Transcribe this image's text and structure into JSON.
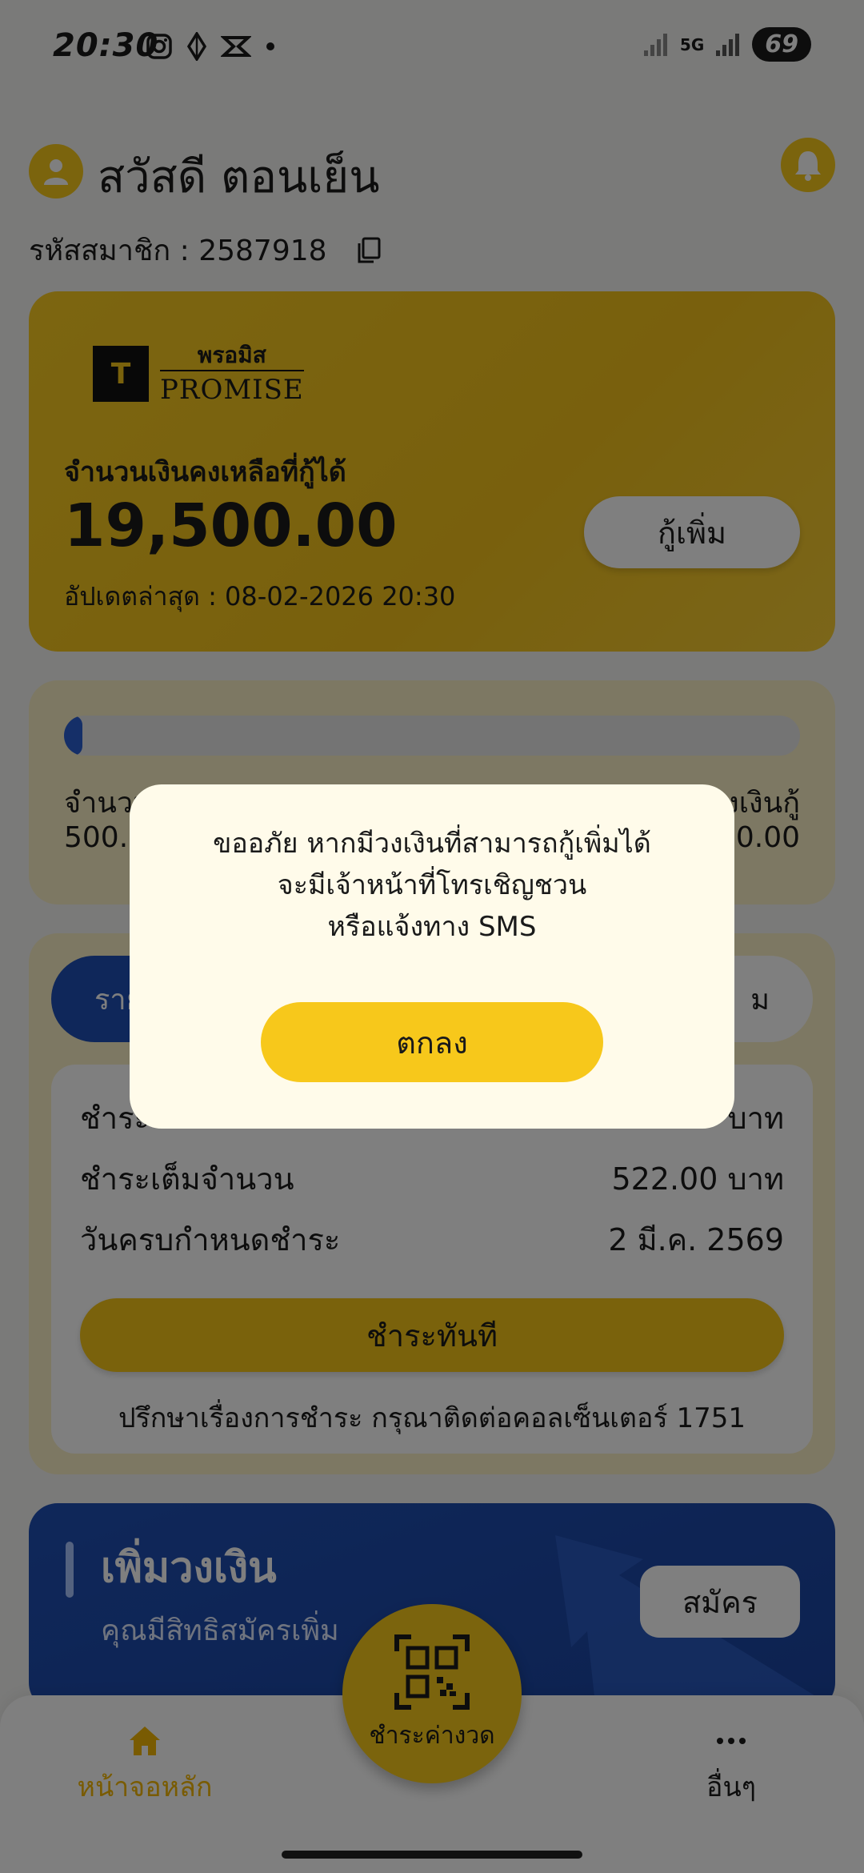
{
  "status_bar": {
    "time": "20:30",
    "network": "5G",
    "battery": "69"
  },
  "header": {
    "greeting": "สวัสดี ตอนเย็น",
    "member_label": "รหัสสมาชิก : 2587918"
  },
  "credit_card": {
    "brand_th": "พรอมิส",
    "brand_en": "PROMISE",
    "label": "จำนวนเงินคงเหลือที่กู้ได้",
    "amount": "19,500.00",
    "updated": "อัปเดตล่าสุด : 08-02-2026 20:30",
    "borrow_more": "กู้เพิ่ม"
  },
  "usage": {
    "progress_percent": 2.5,
    "left_label": "จำนวน",
    "left_value": "500.",
    "right_label": "งเงินกู้",
    "right_value": "0.00"
  },
  "payment": {
    "tab_active": "ราย",
    "tab_other": "ม",
    "rows": [
      {
        "label": "ชำระ",
        "value": "บาท"
      },
      {
        "label": "ชำระเต็มจำนวน",
        "value": "522.00 บาท"
      },
      {
        "label": "วันครบกำหนดชำระ",
        "value": "2 มี.ค. 2569"
      }
    ],
    "pay_now": "ชำระทันที",
    "consult": "ปรึกษาเรื่องการชำระ กรุณาติดต่อคอลเซ็นเตอร์ 1751"
  },
  "banner": {
    "title": "เพิ่มวงเงิน",
    "subtitle": "คุณมีสิทธิสมัครเพิ่ม",
    "apply": "สมัคร"
  },
  "bottom_nav": {
    "home": "หน้าจอหลัก",
    "pay_installment": "ชำระค่างวด",
    "others": "อื่นๆ"
  },
  "dialog": {
    "line1": "ขออภัย หากมีวงเงินที่สามารถกู้เพิ่มได้",
    "line2": "จะมีเจ้าหน้าที่โทรเชิญชวน",
    "line3": "หรือแจ้งทาง SMS",
    "ok": "ตกลง"
  },
  "colors": {
    "brand_yellow": "#f7c81b",
    "brand_blue": "#1f4fb4"
  }
}
